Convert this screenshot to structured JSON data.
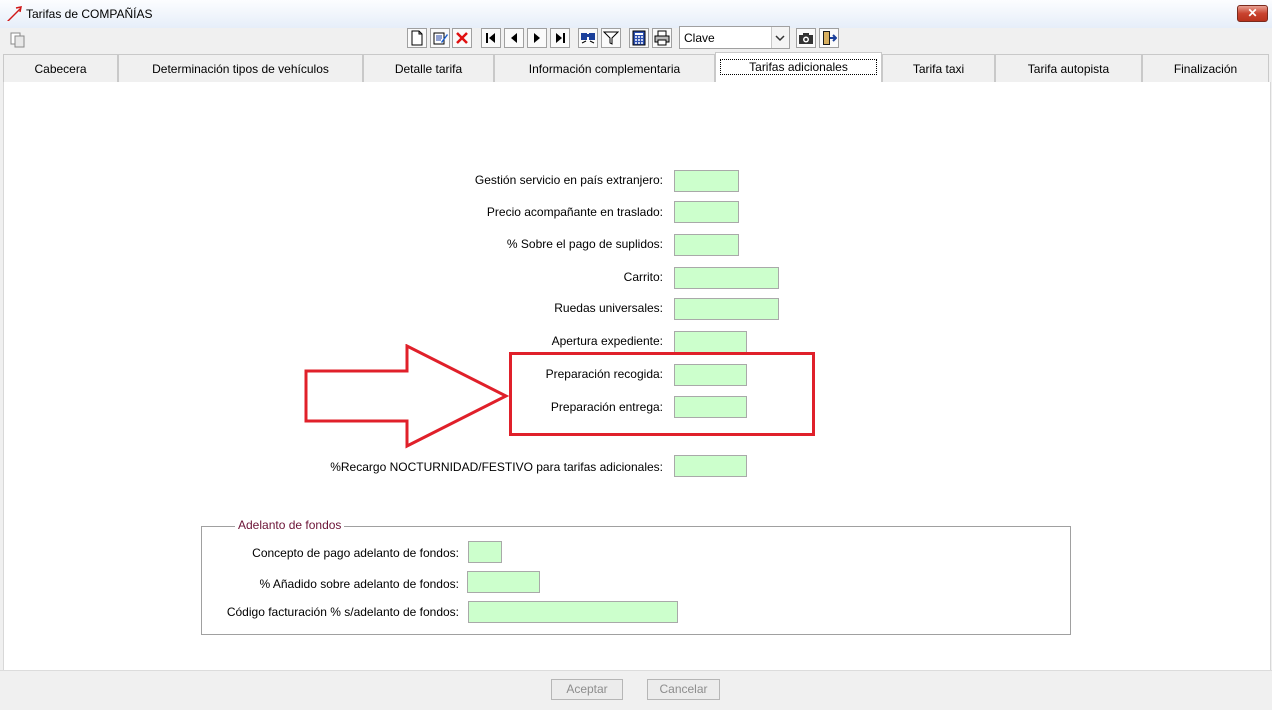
{
  "window": {
    "title": "Tarifas de COMPAÑÍAS",
    "close_label": "✕"
  },
  "toolbar": {
    "clave_value": "Clave"
  },
  "tabs": [
    {
      "label": "Cabecera"
    },
    {
      "label": "Determinación tipos de vehículos"
    },
    {
      "label": "Detalle tarifa"
    },
    {
      "label": "Información complementaria"
    },
    {
      "label": "Tarifas adicionales",
      "active": true
    },
    {
      "label": "Tarifa taxi"
    },
    {
      "label": "Tarifa autopista"
    },
    {
      "label": "Finalización"
    }
  ],
  "form": {
    "fields": [
      {
        "label": "Gestión servicio en país extranjero:",
        "value": ""
      },
      {
        "label": "Precio acompañante en traslado:",
        "value": ""
      },
      {
        "label": "% Sobre el pago de suplidos:",
        "value": ""
      },
      {
        "label": "Carrito:",
        "value": ""
      },
      {
        "label": "Ruedas universales:",
        "value": ""
      },
      {
        "label": "Apertura expediente:",
        "value": ""
      },
      {
        "label": "Preparación recogida:",
        "value": ""
      },
      {
        "label": "Preparación entrega:",
        "value": ""
      },
      {
        "label": "%Recargo NOCTURNIDAD/FESTIVO para tarifas adicionales:",
        "value": ""
      }
    ]
  },
  "adelanto": {
    "title": "Adelanto de fondos",
    "fields": [
      {
        "label": "Concepto de pago adelanto de fondos:",
        "value": ""
      },
      {
        "label": "% Añadido sobre adelanto de fondos:",
        "value": ""
      },
      {
        "label": "Código facturación % s/adelanto de fondos:",
        "value": ""
      }
    ]
  },
  "buttons": {
    "accept": "Aceptar",
    "cancel": "Cancelar"
  },
  "colors": {
    "field_bg": "#ccffcc",
    "annotation": "#e0202a",
    "group_title": "#6b1336"
  },
  "icons": [
    "app-icon",
    "copy-icon",
    "new-doc-icon",
    "edit-icon",
    "delete-icon",
    "first-icon",
    "prev-icon",
    "next-icon",
    "last-icon",
    "search-icon",
    "filter-icon",
    "calculator-icon",
    "print-icon",
    "camera-icon",
    "exit-icon"
  ]
}
